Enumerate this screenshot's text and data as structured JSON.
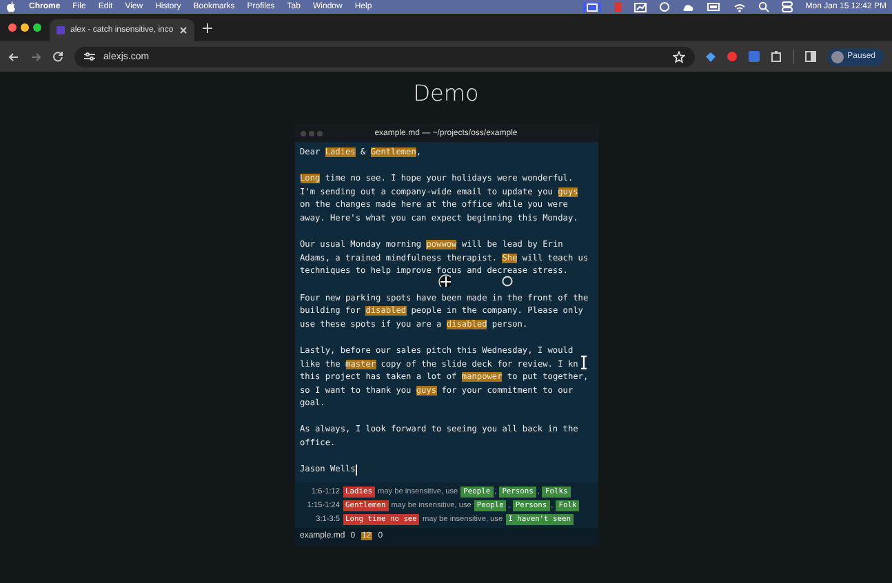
{
  "menu_bar": {
    "app": "Chrome",
    "items": [
      "File",
      "Edit",
      "View",
      "History",
      "Bookmarks",
      "Profiles",
      "Tab",
      "Window",
      "Help"
    ],
    "clock": "Mon Jan 15  12:42 PM"
  },
  "browser": {
    "tab_title": "alex - catch insensitive, inco",
    "url": "alexjs.com",
    "profile": "Paused"
  },
  "page": {
    "heading": "Demo",
    "editor": {
      "title": "example.md — ~/projects/oss/example",
      "paragraphs": [
        [
          [
            {
              "text": "Dear ",
              "flagged": false
            },
            {
              "text": "Ladies",
              "flagged": true
            },
            {
              "text": " & ",
              "flagged": false
            },
            {
              "text": "Gentlemen",
              "flagged": true
            },
            {
              "text": ",",
              "flagged": false
            }
          ]
        ],
        [
          [
            {
              "text": "Long",
              "flagged": true
            },
            {
              "text": " time no see. I hope your holidays were wonderful.",
              "flagged": false
            }
          ],
          [
            {
              "text": "I'm sending out a company-wide email to update you ",
              "flagged": false
            },
            {
              "text": "guys",
              "flagged": true
            }
          ],
          [
            {
              "text": "on the changes made here at the office while you were",
              "flagged": false
            }
          ],
          [
            {
              "text": "away. Here's what you can expect beginning this Monday.",
              "flagged": false
            }
          ]
        ],
        [
          [
            {
              "text": "Our usual Monday morning ",
              "flagged": false
            },
            {
              "text": "powwow",
              "flagged": true
            },
            {
              "text": " will be lead by Erin",
              "flagged": false
            }
          ],
          [
            {
              "text": "Adams, a trained mindfulness therapist. ",
              "flagged": false
            },
            {
              "text": "She",
              "flagged": true
            },
            {
              "text": " will teach us",
              "flagged": false
            }
          ],
          [
            {
              "text": "techniques to help improve focus and decrease stress.",
              "flagged": false
            }
          ]
        ],
        [
          [
            {
              "text": "Four new parking spots have been made in the front of the",
              "flagged": false
            }
          ],
          [
            {
              "text": "building for ",
              "flagged": false
            },
            {
              "text": "disabled",
              "flagged": true
            },
            {
              "text": " people in the company. Please only",
              "flagged": false
            }
          ],
          [
            {
              "text": "use these spots if you are a ",
              "flagged": false
            },
            {
              "text": "disabled",
              "flagged": true
            },
            {
              "text": " person.",
              "flagged": false
            }
          ]
        ],
        [
          [
            {
              "text": "Lastly, before our sales pitch this Wednesday, I would",
              "flagged": false
            }
          ],
          [
            {
              "text": "like the ",
              "flagged": false
            },
            {
              "text": "master",
              "flagged": true
            },
            {
              "text": " copy of the slide deck for review. I kn",
              "flagged": false
            }
          ],
          [
            {
              "text": "this project has taken a lot of ",
              "flagged": false
            },
            {
              "text": "manpower",
              "flagged": true
            },
            {
              "text": " to put together,",
              "flagged": false
            }
          ],
          [
            {
              "text": "so I want to thank you ",
              "flagged": false
            },
            {
              "text": "guys",
              "flagged": true
            },
            {
              "text": " for your commitment to our",
              "flagged": false
            }
          ],
          [
            {
              "text": "goal.",
              "flagged": false
            }
          ]
        ],
        [
          [
            {
              "text": "As always, I look forward to seeing you all back in the",
              "flagged": false
            }
          ],
          [
            {
              "text": "office.",
              "flagged": false
            }
          ]
        ],
        [
          [
            {
              "text": "Jason Wells",
              "flagged": false
            }
          ]
        ]
      ]
    },
    "messages": [
      {
        "position": "1:6-1:12",
        "term": "Ladies",
        "text": "may be insensitive, use",
        "suggestions": [
          "People",
          "Persons",
          "Folks"
        ],
        "separator": ","
      },
      {
        "position": "1:15-1:24",
        "term": "Gentlemen",
        "text": "may be insensitive, use",
        "suggestions": [
          "People",
          "Persons",
          "Folk"
        ],
        "separator": ","
      },
      {
        "position": "3:1-3:5",
        "term": "Long time no see",
        "text": "may be insensitive, use",
        "suggestions": [
          "I haven't seen"
        ]
      }
    ],
    "status": {
      "file": "example.md",
      "counts": [
        {
          "value": "0",
          "kind": "plain"
        },
        {
          "value": "12",
          "kind": "warning"
        },
        {
          "value": "0",
          "kind": "plain"
        }
      ]
    }
  }
}
